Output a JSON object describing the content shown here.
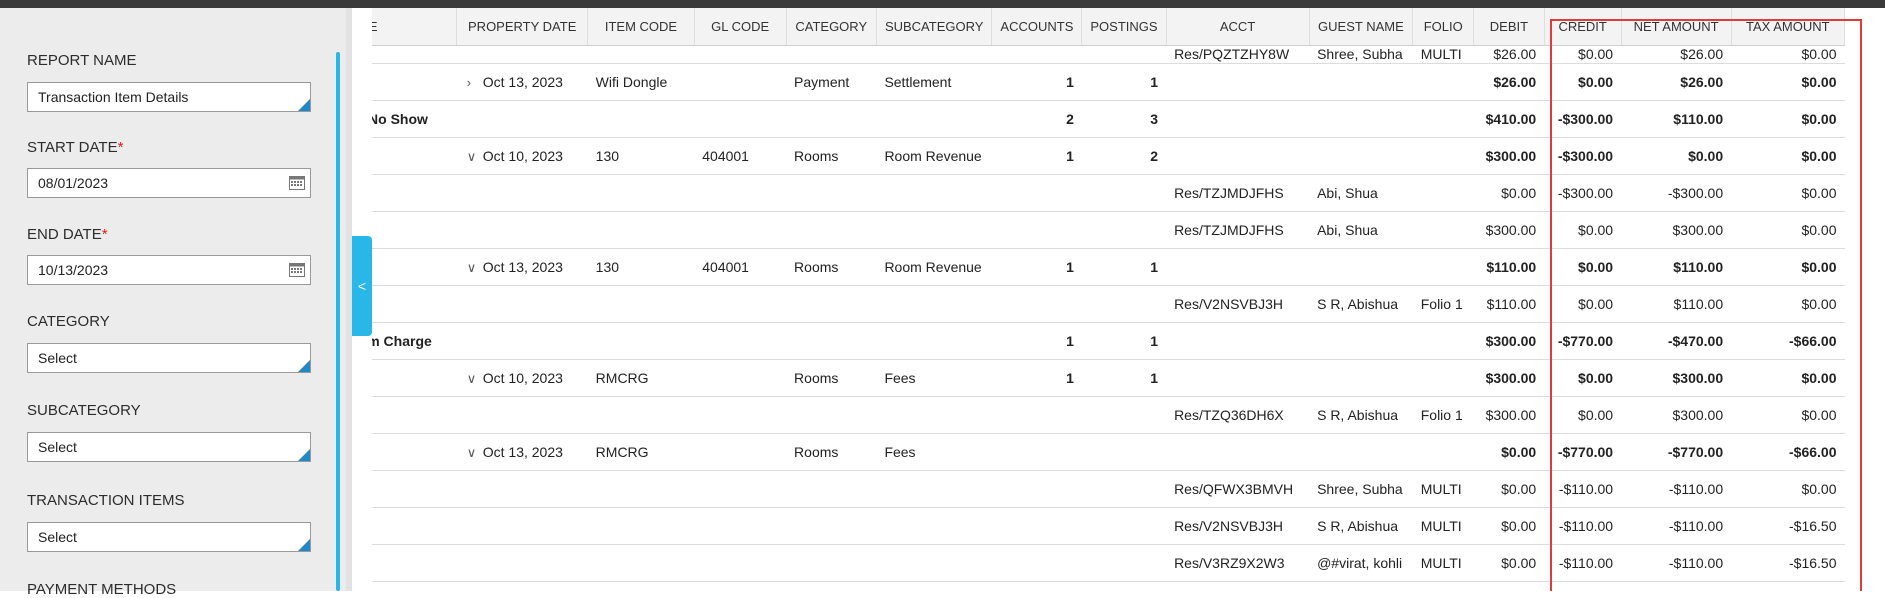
{
  "filters": {
    "report_name": {
      "label": "REPORT NAME",
      "value": "Transaction Item Details"
    },
    "start_date": {
      "label": "START DATE",
      "required": "*",
      "value": "08/01/2023"
    },
    "end_date": {
      "label": "END DATE",
      "required": "*",
      "value": "10/13/2023"
    },
    "category": {
      "label": "CATEGORY",
      "value": "Select"
    },
    "subcategory": {
      "label": "SUBCATEGORY",
      "value": "Select"
    },
    "transaction_items": {
      "label": "TRANSACTION ITEMS",
      "value": "Select"
    },
    "payment_methods": {
      "label": "PAYMENT METHODS"
    }
  },
  "toggle": {
    "icon": "chevron-left-icon",
    "glyph": "<"
  },
  "highlight_color": "#e03a3a",
  "accent_color": "#29b6e8",
  "table": {
    "headers": {
      "name": "NAME",
      "property_date": "PROPERTY DATE",
      "item_code": "ITEM CODE",
      "gl_code": "GL CODE",
      "category": "CATEGORY",
      "subcategory": "SUBCATEGORY",
      "accounts": "ACCOUNTS",
      "postings": "POSTINGS",
      "acct": "ACCT",
      "guest_name": "GUEST NAME",
      "folio": "FOLIO",
      "debit": "DEBIT",
      "credit": "CREDIT",
      "net_amount": "NET AMOUNT",
      "tax_amount": "TAX AMOUNT"
    },
    "rows": [
      {
        "name": "",
        "caret": "",
        "date": "",
        "item": "",
        "gl": "",
        "cat": "",
        "sub": "",
        "accounts": "",
        "postings": "",
        "acct": "Res/PQZTZHY8W",
        "guest": "Shree, Subha",
        "folio": "MULTI",
        "debit": "$26.00",
        "credit": "$0.00",
        "net": "$26.00",
        "tax": "$0.00",
        "bold": false
      },
      {
        "name": "",
        "caret": ">",
        "date": "Oct 13, 2023",
        "item": "Wifi Dongle",
        "gl": "",
        "cat": "Payment",
        "sub": "Settlement",
        "accounts": "1",
        "postings": "1",
        "acct": "",
        "guest": "",
        "folio": "",
        "debit": "$26.00",
        "credit": "$0.00",
        "net": "$26.00",
        "tax": "$0.00",
        "bold": true
      },
      {
        "name": "eed No Show",
        "caret": "",
        "date": "",
        "item": "",
        "gl": "",
        "cat": "",
        "sub": "",
        "accounts": "2",
        "postings": "3",
        "acct": "",
        "guest": "",
        "folio": "",
        "debit": "$410.00",
        "credit": "-$300.00",
        "net": "$110.00",
        "tax": "$0.00",
        "bold": true
      },
      {
        "name": "",
        "caret": "v",
        "date": "Oct 10, 2023",
        "item": "130",
        "gl": "404001",
        "cat": "Rooms",
        "sub": "Room Revenue",
        "accounts": "1",
        "postings": "2",
        "acct": "",
        "guest": "",
        "folio": "",
        "debit": "$300.00",
        "credit": "-$300.00",
        "net": "$0.00",
        "tax": "$0.00",
        "bold": true
      },
      {
        "name": "",
        "caret": "",
        "date": "",
        "item": "",
        "gl": "",
        "cat": "",
        "sub": "",
        "accounts": "",
        "postings": "",
        "acct": "Res/TZJMDJFHS",
        "guest": "Abi, Shua",
        "folio": "",
        "debit": "$0.00",
        "credit": "-$300.00",
        "net": "-$300.00",
        "tax": "$0.00",
        "bold": false
      },
      {
        "name": "",
        "caret": "",
        "date": "",
        "item": "",
        "gl": "",
        "cat": "",
        "sub": "",
        "accounts": "",
        "postings": "",
        "acct": "Res/TZJMDJFHS",
        "guest": "Abi, Shua",
        "folio": "",
        "debit": "$300.00",
        "credit": "$0.00",
        "net": "$300.00",
        "tax": "$0.00",
        "bold": false
      },
      {
        "name": "",
        "caret": "v",
        "date": "Oct 13, 2023",
        "item": "130",
        "gl": "404001",
        "cat": "Rooms",
        "sub": "Room Revenue",
        "accounts": "1",
        "postings": "1",
        "acct": "",
        "guest": "",
        "folio": "",
        "debit": "$110.00",
        "credit": "$0.00",
        "net": "$110.00",
        "tax": "$0.00",
        "bold": true
      },
      {
        "name": "",
        "caret": "",
        "date": "",
        "item": "",
        "gl": "",
        "cat": "",
        "sub": "",
        "accounts": "",
        "postings": "",
        "acct": "Res/V2NSVBJ3H",
        "guest": "S R, Abishua",
        "folio": "Folio 1",
        "debit": "$110.00",
        "credit": "$0.00",
        "net": "$110.00",
        "tax": "$0.00",
        "bold": false
      },
      {
        "name": "Room Charge",
        "caret": "",
        "date": "",
        "item": "",
        "gl": "",
        "cat": "",
        "sub": "",
        "accounts": "1",
        "postings": "1",
        "acct": "",
        "guest": "",
        "folio": "",
        "debit": "$300.00",
        "credit": "-$770.00",
        "net": "-$470.00",
        "tax": "-$66.00",
        "bold": true
      },
      {
        "name": "",
        "caret": "v",
        "date": "Oct 10, 2023",
        "item": "RMCRG",
        "gl": "",
        "cat": "Rooms",
        "sub": "Fees",
        "accounts": "1",
        "postings": "1",
        "acct": "",
        "guest": "",
        "folio": "",
        "debit": "$300.00",
        "credit": "$0.00",
        "net": "$300.00",
        "tax": "$0.00",
        "bold": true
      },
      {
        "name": "",
        "caret": "",
        "date": "",
        "item": "",
        "gl": "",
        "cat": "",
        "sub": "",
        "accounts": "",
        "postings": "",
        "acct": "Res/TZQ36DH6X",
        "guest": "S R, Abishua",
        "folio": "Folio 1",
        "debit": "$300.00",
        "credit": "$0.00",
        "net": "$300.00",
        "tax": "$0.00",
        "bold": false
      },
      {
        "name": "",
        "caret": "v",
        "date": "Oct 13, 2023",
        "item": "RMCRG",
        "gl": "",
        "cat": "Rooms",
        "sub": "Fees",
        "accounts": "",
        "postings": "",
        "acct": "",
        "guest": "",
        "folio": "",
        "debit": "$0.00",
        "credit": "-$770.00",
        "net": "-$770.00",
        "tax": "-$66.00",
        "bold": true
      },
      {
        "name": "",
        "caret": "",
        "date": "",
        "item": "",
        "gl": "",
        "cat": "",
        "sub": "",
        "accounts": "",
        "postings": "",
        "acct": "Res/QFWX3BMVH",
        "guest": "Shree, Subha",
        "folio": "MULTI",
        "debit": "$0.00",
        "credit": "-$110.00",
        "net": "-$110.00",
        "tax": "$0.00",
        "bold": false
      },
      {
        "name": "",
        "caret": "",
        "date": "",
        "item": "",
        "gl": "",
        "cat": "",
        "sub": "",
        "accounts": "",
        "postings": "",
        "acct": "Res/V2NSVBJ3H",
        "guest": "S R, Abishua",
        "folio": "MULTI",
        "debit": "$0.00",
        "credit": "-$110.00",
        "net": "-$110.00",
        "tax": "-$16.50",
        "bold": false
      },
      {
        "name": "",
        "caret": "",
        "date": "",
        "item": "",
        "gl": "",
        "cat": "",
        "sub": "",
        "accounts": "",
        "postings": "",
        "acct": "Res/V3RZ9X2W3",
        "guest": "@#virat, kohli",
        "folio": "MULTI",
        "debit": "$0.00",
        "credit": "-$110.00",
        "net": "-$110.00",
        "tax": "-$16.50",
        "bold": false
      }
    ]
  }
}
